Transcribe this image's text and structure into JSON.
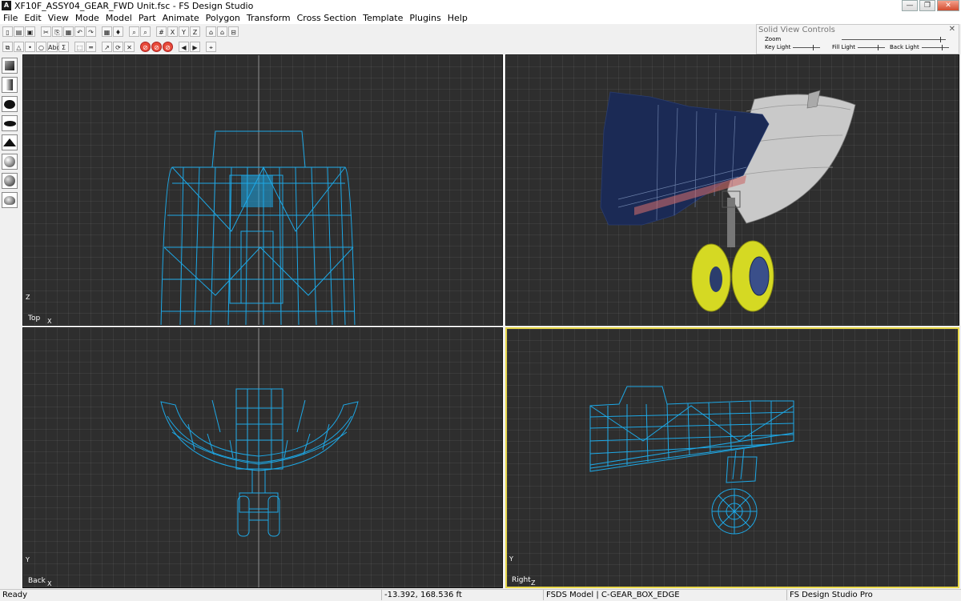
{
  "window": {
    "title": "XF10F_ASSY04_GEAR_FWD Unit.fsc - FS Design Studio",
    "app_icon": "fsds-app-icon",
    "minimize": "—",
    "maximize": "❐",
    "close": "✕"
  },
  "menu": [
    "File",
    "Edit",
    "View",
    "Mode",
    "Model",
    "Part",
    "Animate",
    "Polygon",
    "Transform",
    "Cross Section",
    "Template",
    "Plugins",
    "Help"
  ],
  "toolbar1": [
    "new-icon",
    "open-icon",
    "save-icon",
    "sep",
    "cut-icon",
    "copy-icon",
    "paste-icon",
    "undo-icon",
    "redo-icon",
    "sep",
    "print-icon",
    "light-bulb-icon",
    "sep",
    "zoom-in-icon",
    "zoom-out-icon",
    "sep",
    "grid-icon",
    "snap-x-icon",
    "snap-y-icon",
    "snap-z-icon",
    "sep",
    "view-top-icon",
    "view-front-icon",
    "view-side-icon"
  ],
  "toolbar1_glyphs": [
    "▯",
    "▤",
    "▣",
    "",
    "✂",
    "⎘",
    "▦",
    "↶",
    "↷",
    "",
    "▦",
    "♦",
    "",
    "⌕",
    "⌕",
    "",
    "#",
    "X",
    "Y",
    "Z",
    "",
    "⌂",
    "⌂",
    "⊟"
  ],
  "toolbar2": [
    "select-icon",
    "triangle-icon",
    "point-icon",
    "circle-icon",
    "text-icon",
    "sigma-icon",
    "sep",
    "bounding-box-icon",
    "line-icon",
    "sep",
    "move-icon",
    "rotate-icon",
    "scale-icon",
    "sep",
    "no-entry-icon",
    "no-entry-2-icon",
    "no-entry-3-icon",
    "sep",
    "prev-icon",
    "next-icon",
    "sep",
    "binoculars-icon"
  ],
  "toolbar2_glyphs": [
    "⧉",
    "△",
    "•",
    "○",
    "Abc",
    "Σ",
    "",
    "⬚",
    "═",
    "",
    "↗",
    "⟳",
    "✕",
    "",
    "⊘",
    "⊘",
    "⊘",
    "",
    "◀",
    "▶",
    "",
    "⌖"
  ],
  "solid_view_controls": {
    "title": "Solid View Controls",
    "close": "✕",
    "zoom_label": "Zoom",
    "key_light_label": "Key Light",
    "fill_light_label": "Fill Light",
    "back_light_label": "Back Light"
  },
  "sidebar_tools": [
    "cube-icon",
    "cylinder-icon",
    "sphere-icon",
    "ellipsoid-icon",
    "wedge-icon",
    "shaded-sphere-icon",
    "textured-sphere-icon",
    "hemisphere-icon"
  ],
  "viewports": {
    "top": {
      "label": "Top",
      "axis_v": "Z",
      "axis_h": "X"
    },
    "solid": {
      "label": ""
    },
    "back": {
      "label": "Back",
      "axis_v": "Y",
      "axis_h": "X"
    },
    "right": {
      "label": "Right",
      "axis_v": "Y",
      "axis_h": "Z"
    }
  },
  "colors": {
    "wireframe": "#1da8e6",
    "active_border": "#e8d84a",
    "viewport_bg": "#2e2e2e",
    "hull_navy": "#1b2a55",
    "tire_yellow": "#d5d923"
  },
  "status": {
    "state": "Ready",
    "coords": "-13.392, 168.536 ft",
    "model": "FSDS Model | C-GEAR_BOX_EDGE",
    "product": "FS Design Studio Pro"
  }
}
